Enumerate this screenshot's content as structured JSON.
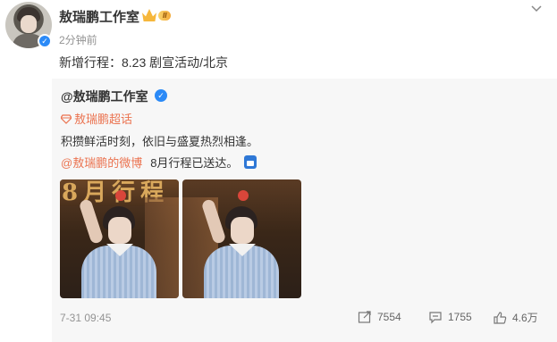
{
  "post": {
    "author": "敖瑞鹏工作室",
    "vip_level": "II",
    "time": "2分钟前",
    "text": "新增行程：8.23 剧宣活动/北京"
  },
  "repost": {
    "author": "@敖瑞鹏工作室",
    "super_topic": "敖瑞鹏超话",
    "text": "积攒鲜活时刻，依旧与盛夏热烈相逢。",
    "link_text": "@敖瑞鹏的微博",
    "link_suffix": "8月行程已送达。",
    "photo_title": "8月行程",
    "timestamp": "7-31 09:45",
    "stats": {
      "shares": "7554",
      "comments": "1755",
      "likes": "4.6万"
    }
  },
  "icons": [
    "chevron-down-icon",
    "verified-icon",
    "crown-icon",
    "diamond-icon",
    "schedule-icon",
    "share-icon",
    "comment-icon",
    "like-icon"
  ],
  "colors": {
    "accent": "#eb7350",
    "verify_blue": "#2b8af7",
    "muted": "#939393",
    "repost_bg": "#f7f7f7"
  }
}
